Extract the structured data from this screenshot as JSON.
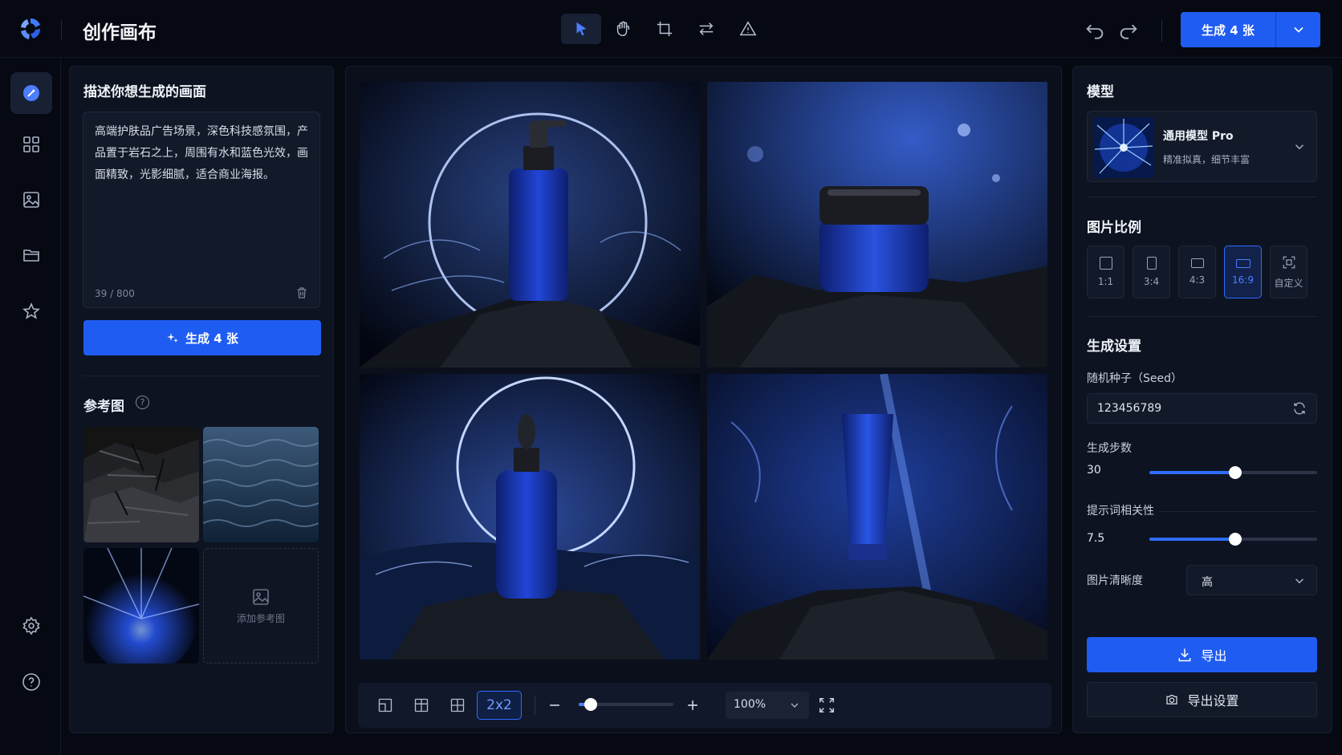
{
  "app": {
    "title": "创作画布"
  },
  "toolbar": {
    "tools": [
      "select-icon",
      "hand-icon",
      "crop-icon",
      "swap-icon",
      "warning-icon"
    ],
    "generate_label": "生成 4 张"
  },
  "sidebar": {
    "items": [
      "brush-icon",
      "grid-icon",
      "image-icon",
      "folder-icon",
      "star-icon",
      "settings-icon",
      "help-icon"
    ]
  },
  "prompt": {
    "title": "描述你想生成的画面",
    "text": "高端护肤品广告场景，深色科技感氛围，产品置于岩石之上，周围有水和蓝色光效，画面精致，光影细腻，适合商业海报。",
    "counter": "39 / 800",
    "generate_label": "生成 4 张"
  },
  "reference": {
    "title": "参考图",
    "help": "?",
    "add_label": "添加参考图"
  },
  "canvas": {
    "layout_active_label": "2x2",
    "zoom": "100%",
    "zoom_level": 0.13
  },
  "model": {
    "section": "模型",
    "name": "通用模型 Pro",
    "desc": "精准拟真，细节丰富"
  },
  "ratio": {
    "section": "图片比例",
    "options": [
      "1:1",
      "3:4",
      "4:3",
      "16:9",
      "自定义"
    ],
    "active": "16:9"
  },
  "settings": {
    "section": "生成设置",
    "seed_label": "随机种子（Seed）",
    "seed_value": "123456789",
    "steps_label": "生成步数",
    "steps_value": "30",
    "steps_fraction": 0.51,
    "cfg_label": "提示词相关性",
    "cfg_value": "7.5",
    "cfg_fraction": 0.51,
    "quality_label": "图片清晰度",
    "quality_value": "高"
  },
  "actions": {
    "export": "导出",
    "export_settings": "导出设置"
  },
  "colors": {
    "accent": "#1f5cf2",
    "bg": "#060912",
    "panel": "#0d1321"
  }
}
